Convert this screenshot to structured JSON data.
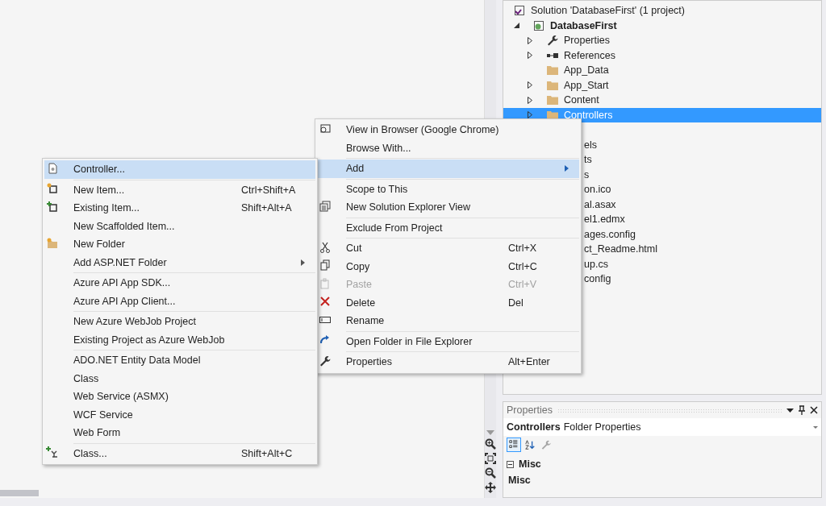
{
  "solution_explorer": {
    "solution": "Solution 'DatabaseFirst' (1 project)",
    "project": {
      "label": "DatabaseFirst",
      "expanded": true,
      "children": [
        {
          "label": "Properties",
          "kind": "wrench",
          "expandable": true,
          "selected": false
        },
        {
          "label": "References",
          "kind": "references",
          "expandable": true,
          "selected": false
        },
        {
          "label": "App_Data",
          "kind": "folder",
          "expandable": false,
          "selected": false
        },
        {
          "label": "App_Start",
          "kind": "folder",
          "expandable": true,
          "selected": false
        },
        {
          "label": "Content",
          "kind": "folder",
          "expandable": true,
          "selected": false
        },
        {
          "label": "Controllers",
          "kind": "folder",
          "expandable": true,
          "selected": true
        }
      ]
    },
    "partly_hidden_items": [
      "els",
      "ts",
      "s",
      "on.ico",
      "al.asax",
      "el1.edmx",
      "ages.config",
      "ct_Readme.html",
      "up.cs",
      "config"
    ]
  },
  "context_menu": {
    "groups": [
      [
        {
          "label": "View in Browser (Google Chrome)",
          "kind": "browser",
          "selected": false,
          "disabled": false,
          "submenu": false
        },
        {
          "label": "Browse With...",
          "selected": false,
          "disabled": false,
          "submenu": false
        }
      ],
      [
        {
          "label": "Add",
          "selected": true,
          "disabled": false,
          "submenu": true
        }
      ],
      [
        {
          "label": "Scope to This",
          "selected": false,
          "disabled": false,
          "submenu": false
        },
        {
          "label": "New Solution Explorer View",
          "kind": "explorer",
          "selected": false,
          "disabled": false,
          "submenu": false
        }
      ],
      [
        {
          "label": "Exclude From Project",
          "selected": false,
          "disabled": false,
          "submenu": false
        }
      ],
      [
        {
          "label": "Cut",
          "shortcut": "Ctrl+X",
          "kind": "cut",
          "selected": false,
          "disabled": false,
          "submenu": false
        },
        {
          "label": "Copy",
          "shortcut": "Ctrl+C",
          "kind": "copy",
          "selected": false,
          "disabled": false,
          "submenu": false
        },
        {
          "label": "Paste",
          "shortcut": "Ctrl+V",
          "kind": "paste",
          "selected": false,
          "disabled": true,
          "submenu": false
        },
        {
          "label": "Delete",
          "shortcut": "Del",
          "kind": "delete",
          "selected": false,
          "disabled": false,
          "submenu": false
        },
        {
          "label": "Rename",
          "kind": "rename",
          "selected": false,
          "disabled": false,
          "submenu": false
        }
      ],
      [
        {
          "label": "Open Folder in File Explorer",
          "kind": "openfolder",
          "selected": false,
          "disabled": false,
          "submenu": false
        }
      ],
      [
        {
          "label": "Properties",
          "shortcut": "Alt+Enter",
          "kind": "wrench",
          "selected": false,
          "disabled": false,
          "submenu": false
        }
      ]
    ]
  },
  "add_submenu": {
    "groups": [
      [
        {
          "label": "Controller...",
          "kind": "controller",
          "selected": true,
          "submenu": false
        }
      ],
      [
        {
          "label": "New Item...",
          "shortcut": "Ctrl+Shift+A",
          "kind": "newitem",
          "selected": false,
          "submenu": false
        },
        {
          "label": "Existing Item...",
          "shortcut": "Shift+Alt+A",
          "kind": "existingitem",
          "selected": false,
          "submenu": false
        },
        {
          "label": "New Scaffolded Item...",
          "selected": false,
          "submenu": false
        },
        {
          "label": "New Folder",
          "kind": "newfolder",
          "selected": false,
          "submenu": false
        },
        {
          "label": "Add ASP.NET Folder",
          "selected": false,
          "submenu": true
        }
      ],
      [
        {
          "label": "Azure API App SDK...",
          "selected": false,
          "submenu": false
        },
        {
          "label": "Azure API App Client...",
          "selected": false,
          "submenu": false
        }
      ],
      [
        {
          "label": "New Azure WebJob Project",
          "selected": false,
          "submenu": false
        },
        {
          "label": "Existing Project as Azure WebJob",
          "selected": false,
          "submenu": false
        }
      ],
      [
        {
          "label": "ADO.NET Entity Data Model",
          "selected": false,
          "submenu": false
        },
        {
          "label": "Class",
          "selected": false,
          "submenu": false
        },
        {
          "label": "Web Service (ASMX)",
          "selected": false,
          "submenu": false
        },
        {
          "label": "WCF Service",
          "selected": false,
          "submenu": false
        },
        {
          "label": "Web Form",
          "selected": false,
          "submenu": false
        }
      ],
      [
        {
          "label": "Class...",
          "shortcut": "Shift+Alt+C",
          "kind": "class",
          "selected": false,
          "submenu": false
        }
      ]
    ]
  },
  "properties": {
    "title": "Properties",
    "object_name": "Controllers",
    "object_type": "Folder Properties",
    "toolbar": [
      {
        "kind": "categorized",
        "selected": true,
        "disabled": false
      },
      {
        "kind": "alphabetical",
        "selected": false,
        "disabled": false
      },
      {
        "kind": "pages",
        "selected": false,
        "disabled": true
      }
    ],
    "category": {
      "label": "Misc",
      "expanded": true
    },
    "description": "Misc"
  }
}
